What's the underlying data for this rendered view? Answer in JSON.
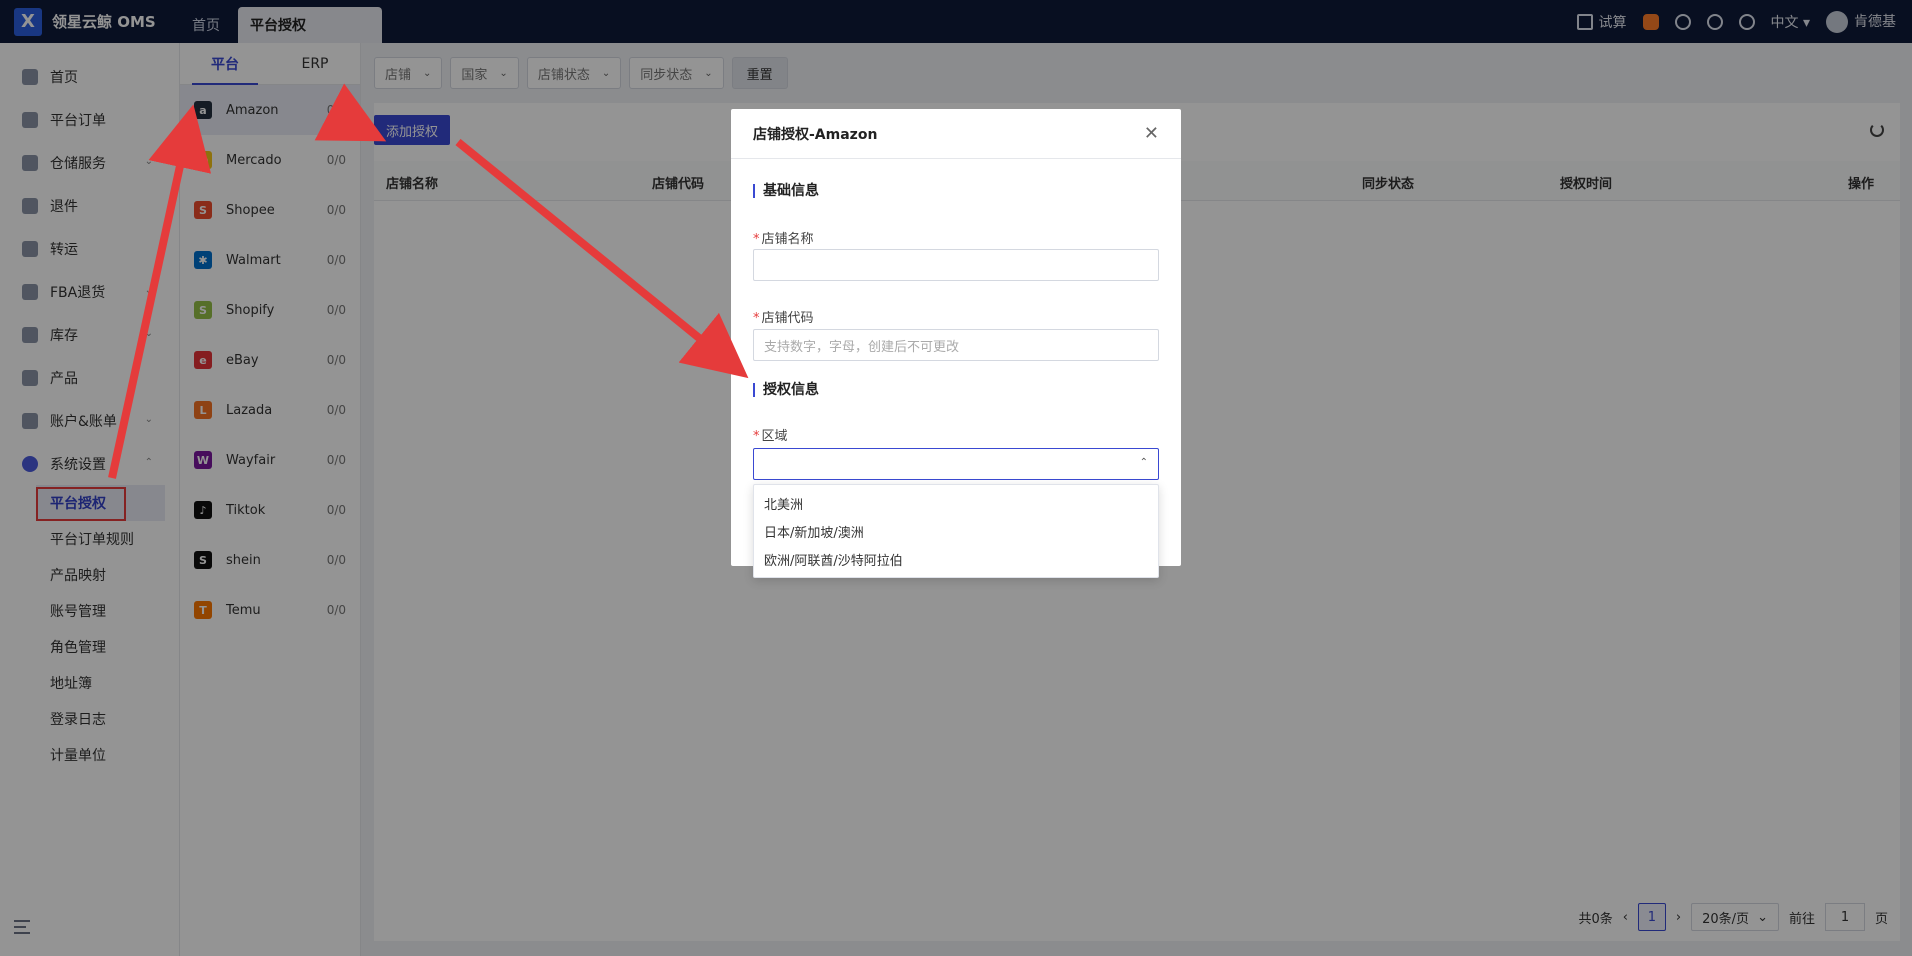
{
  "app": {
    "title": "领星云鲸 OMS"
  },
  "tabs": [
    {
      "label": "首页"
    },
    {
      "label": "平台授权"
    }
  ],
  "top_right": {
    "trial_label": "试算",
    "language": "中文",
    "user_name": "肯德基"
  },
  "sidebar": {
    "items": [
      {
        "label": "首页",
        "icon": "home-icon"
      },
      {
        "label": "平台订单",
        "icon": "order-icon"
      },
      {
        "label": "仓储服务",
        "icon": "warehouse-icon",
        "expandable": true
      },
      {
        "label": "退件",
        "icon": "return-icon"
      },
      {
        "label": "转运",
        "icon": "transfer-icon"
      },
      {
        "label": "FBA退货",
        "icon": "fba-icon",
        "expandable": true
      },
      {
        "label": "库存",
        "icon": "inventory-icon",
        "expandable": true
      },
      {
        "label": "产品",
        "icon": "product-icon"
      },
      {
        "label": "账户&账单",
        "icon": "account-icon",
        "expandable": true
      },
      {
        "label": "系统设置",
        "icon": "settings-icon",
        "expandable": true,
        "open": true
      }
    ],
    "sub_items": [
      {
        "label": "平台授权",
        "active": true
      },
      {
        "label": "平台订单规则"
      },
      {
        "label": "产品映射"
      },
      {
        "label": "账号管理"
      },
      {
        "label": "角色管理"
      },
      {
        "label": "地址簿"
      },
      {
        "label": "登录日志"
      },
      {
        "label": "计量单位"
      }
    ]
  },
  "platform_panel": {
    "tabs": [
      {
        "label": "平台"
      },
      {
        "label": "ERP"
      }
    ],
    "platforms": [
      {
        "name": "Amazon",
        "count": "0/0",
        "color": "#232f3e",
        "glyph": "a"
      },
      {
        "name": "Mercado",
        "count": "0/0",
        "color": "#f5c518",
        "glyph": "m"
      },
      {
        "name": "Shopee",
        "count": "0/0",
        "color": "#ee4d2d",
        "glyph": "S"
      },
      {
        "name": "Walmart",
        "count": "0/0",
        "color": "#0071ce",
        "glyph": "✱"
      },
      {
        "name": "Shopify",
        "count": "0/0",
        "color": "#95bf47",
        "glyph": "S"
      },
      {
        "name": "eBay",
        "count": "0/0",
        "color": "#e53238",
        "glyph": "e"
      },
      {
        "name": "Lazada",
        "count": "0/0",
        "color": "#f57224",
        "glyph": "L"
      },
      {
        "name": "Wayfair",
        "count": "0/0",
        "color": "#7b189f",
        "glyph": "W"
      },
      {
        "name": "Tiktok",
        "count": "0/0",
        "color": "#111111",
        "glyph": "♪"
      },
      {
        "name": "shein",
        "count": "0/0",
        "color": "#111111",
        "glyph": "S"
      },
      {
        "name": "Temu",
        "count": "0/0",
        "color": "#fb7701",
        "glyph": "T"
      }
    ]
  },
  "filters": {
    "shop": "店铺",
    "country": "国家",
    "shop_status": "店铺状态",
    "sync_status": "同步状态",
    "reset_label": "重置"
  },
  "toolbar": {
    "add_label": "添加授权"
  },
  "table": {
    "headers": [
      "店铺名称",
      "店铺代码",
      "同步状态",
      "授权时间",
      "操作"
    ]
  },
  "pagination": {
    "total_text": "共0条",
    "current_page": "1",
    "page_size": "20条/页",
    "goto_label": "前往",
    "goto_value": "1",
    "page_suffix": "页"
  },
  "modal": {
    "title": "店铺授权-Amazon",
    "section_basic": "基础信息",
    "shop_name_label": "店铺名称",
    "shop_code_label": "店铺代码",
    "shop_code_placeholder": "支持数字，字母，创建后不可更改",
    "section_auth": "授权信息",
    "region_label": "区域",
    "region_options": [
      "北美洲",
      "日本/新加坡/澳洲",
      "欧洲/阿联酋/沙特阿拉伯"
    ]
  },
  "colors": {
    "topbar": "#0f1a3a",
    "accent": "#3a49d2",
    "annotation": "#e53b3b"
  }
}
